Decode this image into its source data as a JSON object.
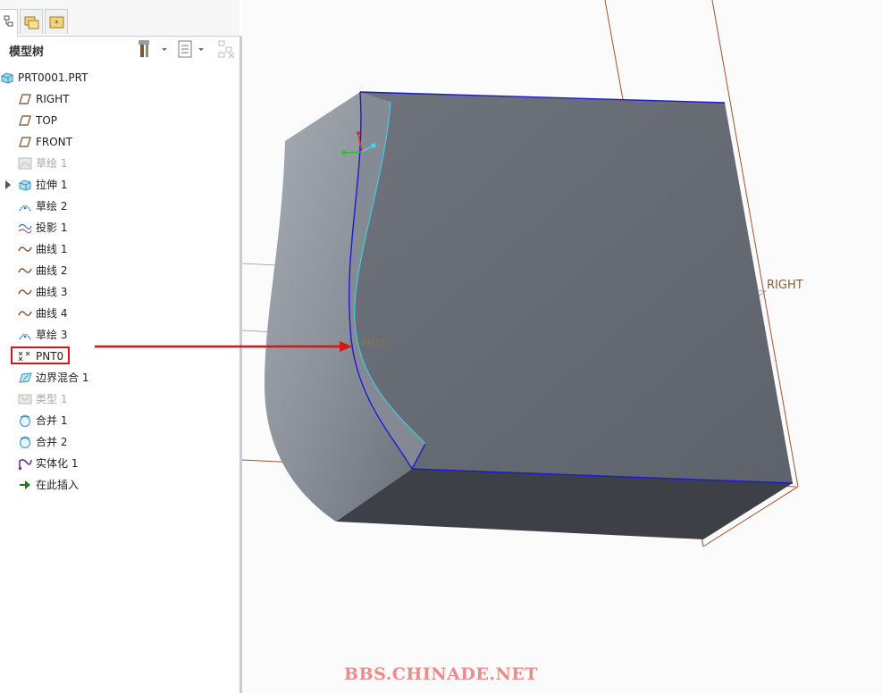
{
  "panel": {
    "title": "模型树",
    "tabs": [
      {
        "name": "model-tree-tab",
        "icon": "tree-icon",
        "active": true
      },
      {
        "name": "layers-tab",
        "icon": "folders-icon",
        "active": false
      },
      {
        "name": "favorites-tab",
        "icon": "star-folder-icon",
        "active": false
      }
    ],
    "header_buttons": [
      "settings-tools-icon",
      "show-options-icon",
      "filter-icon"
    ]
  },
  "tree": {
    "items": [
      {
        "label": "PRT0001.PRT",
        "icon": "part-icon",
        "dim": false
      },
      {
        "label": "RIGHT",
        "icon": "datum-plane-icon",
        "dim": false
      },
      {
        "label": "TOP",
        "icon": "datum-plane-icon",
        "dim": false
      },
      {
        "label": "FRONT",
        "icon": "datum-plane-icon",
        "dim": false
      },
      {
        "label": "草绘 1",
        "icon": "sketch-icon",
        "dim": true
      },
      {
        "label": "拉伸 1",
        "icon": "extrude-icon",
        "dim": false,
        "expandable": true
      },
      {
        "label": "草绘 2",
        "icon": "sketch-icon",
        "dim": false
      },
      {
        "label": "投影 1",
        "icon": "projection-icon",
        "dim": false
      },
      {
        "label": "曲线 1",
        "icon": "curve-icon",
        "dim": false
      },
      {
        "label": "曲线 2",
        "icon": "curve-icon",
        "dim": false
      },
      {
        "label": "曲线 3",
        "icon": "curve-icon",
        "dim": false
      },
      {
        "label": "曲线 4",
        "icon": "curve-icon",
        "dim": false
      },
      {
        "label": "草绘 3",
        "icon": "sketch-icon",
        "dim": false
      },
      {
        "label": "PNT0",
        "icon": "datum-point-icon",
        "dim": false,
        "highlighted": true
      },
      {
        "label": "边界混合 1",
        "icon": "boundary-blend-icon",
        "dim": false
      },
      {
        "label": "类型 1",
        "icon": "type-icon",
        "dim": true
      },
      {
        "label": "合并 1",
        "icon": "merge-icon",
        "dim": false
      },
      {
        "label": "合并 2",
        "icon": "merge-icon",
        "dim": false
      },
      {
        "label": "实体化 1",
        "icon": "solidify-icon",
        "dim": false
      },
      {
        "label": "在此插入",
        "icon": "insert-here-arrow-icon",
        "dim": false
      }
    ]
  },
  "viewport": {
    "plane_label": "RIGHT",
    "point_label": "PNT0"
  },
  "watermark": "BBS.CHINADE.NET",
  "colors": {
    "highlight_red": "#d01818",
    "plane_brown": "#a0522d",
    "edge_blue": "#1a1acf",
    "face_front": "#6b7079",
    "face_side": "#8d939c",
    "face_bottom": "#3d4047"
  }
}
